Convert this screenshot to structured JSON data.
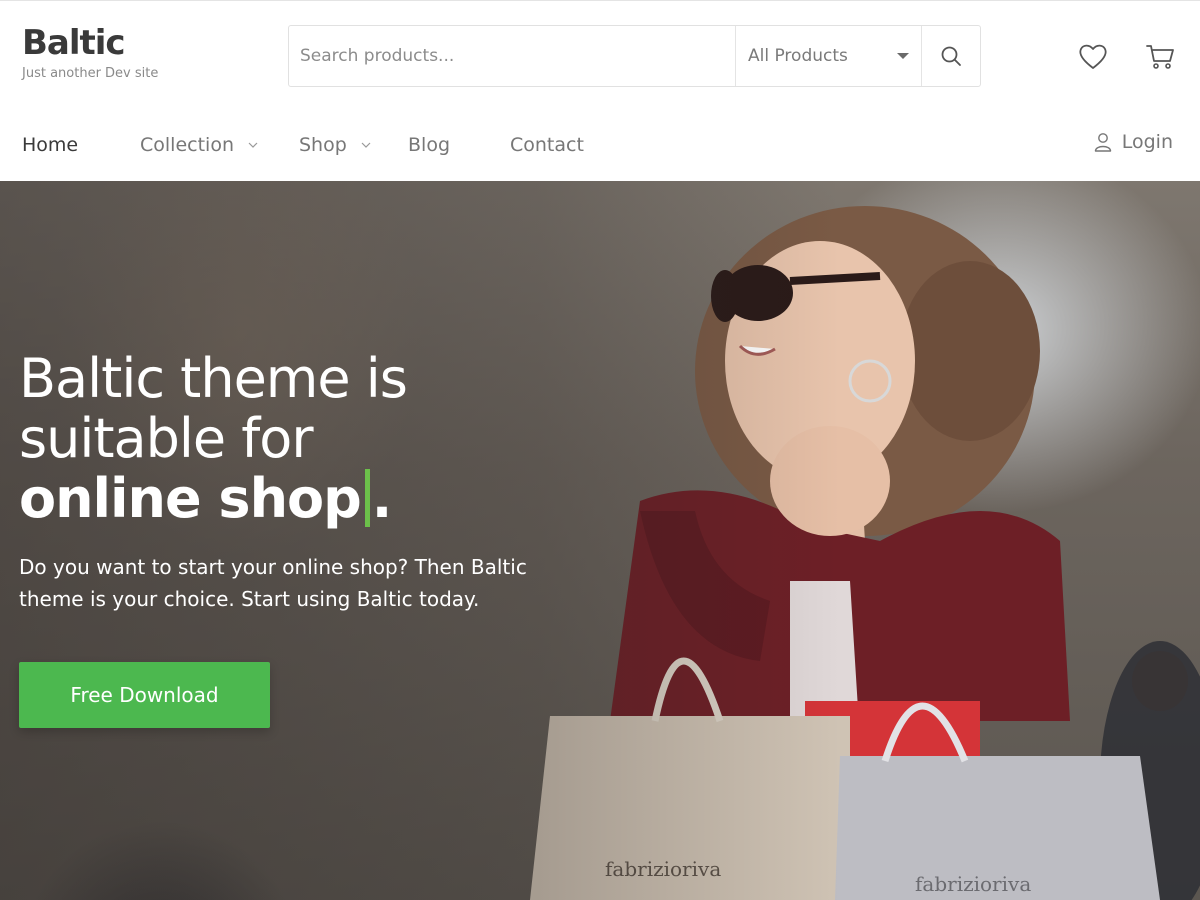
{
  "site": {
    "title": "Baltic",
    "tagline": "Just another Dev site"
  },
  "search": {
    "placeholder": "Search products...",
    "category": "All Products"
  },
  "icons": {
    "search": "search-icon",
    "wishlist": "heart-icon",
    "cart": "cart-icon",
    "user": "user-icon"
  },
  "nav": {
    "items": [
      {
        "label": "Home",
        "active": true,
        "dropdown": false
      },
      {
        "label": "Collection",
        "active": false,
        "dropdown": true
      },
      {
        "label": "Shop",
        "active": false,
        "dropdown": true
      },
      {
        "label": "Blog",
        "active": false,
        "dropdown": false
      },
      {
        "label": "Contact",
        "active": false,
        "dropdown": false
      }
    ],
    "login_label": "Login"
  },
  "hero": {
    "heading_line1": "Baltic theme is",
    "heading_line2": "suitable for",
    "heading_line3": "online shop",
    "heading_end": ".",
    "subtext": "Do you want to start your online shop? Then Baltic theme is your choice. Start using Baltic today.",
    "cta_label": "Free Download",
    "bag_brand_1": "fabrizioriva",
    "bag_brand_2": "fabrizioriva"
  },
  "colors": {
    "accent": "#4cb84f",
    "cursor": "#6cc04a",
    "text_dark": "#3a3a3a",
    "text_muted": "#777777"
  }
}
